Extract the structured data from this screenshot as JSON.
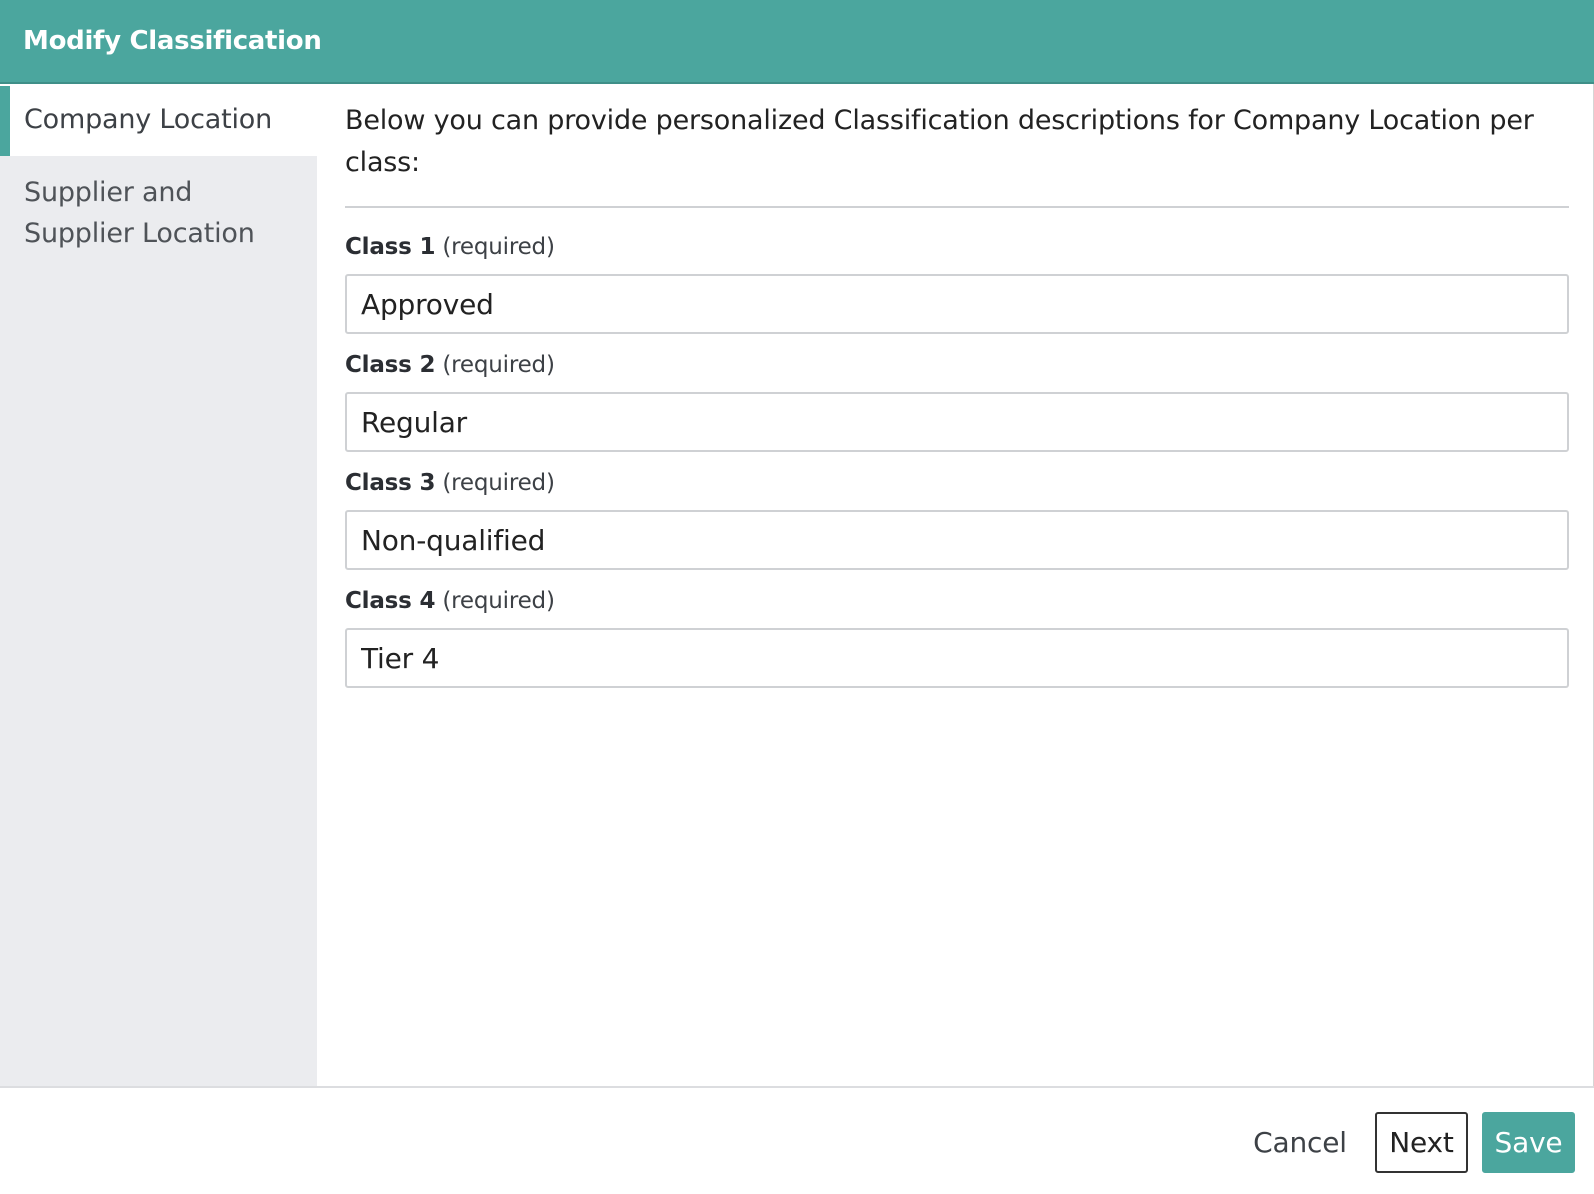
{
  "header": {
    "title": "Modify Classification"
  },
  "sidebar": {
    "items": [
      {
        "label": "Company Location",
        "active": true
      },
      {
        "label": "Supplier and Supplier Location",
        "active": false
      }
    ]
  },
  "main": {
    "intro": "Below you can provide personalized Classification descriptions for Company Location per class:",
    "fields": [
      {
        "name": "Class 1",
        "suffix": "(required)",
        "value": "Approved"
      },
      {
        "name": "Class 2",
        "suffix": "(required)",
        "value": "Regular"
      },
      {
        "name": "Class 3",
        "suffix": "(required)",
        "value": "Non-qualified"
      },
      {
        "name": "Class 4",
        "suffix": "(required)",
        "value": "Tier 4"
      }
    ]
  },
  "footer": {
    "cancel_label": "Cancel",
    "next_label": "Next",
    "save_label": "Save"
  },
  "colors": {
    "accent": "#4ba69e",
    "sidebar_bg": "#ebecef"
  }
}
